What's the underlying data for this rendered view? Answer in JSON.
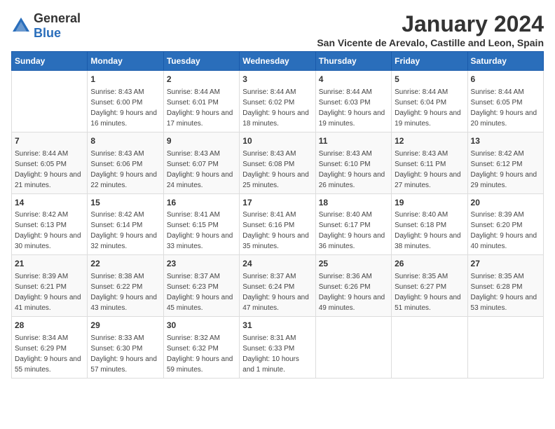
{
  "logo": {
    "text_general": "General",
    "text_blue": "Blue"
  },
  "header": {
    "month_title": "January 2024",
    "subtitle": "San Vicente de Arevalo, Castille and Leon, Spain"
  },
  "days_of_week": [
    "Sunday",
    "Monday",
    "Tuesday",
    "Wednesday",
    "Thursday",
    "Friday",
    "Saturday"
  ],
  "weeks": [
    [
      {
        "day": "",
        "sunrise": "",
        "sunset": "",
        "daylight": ""
      },
      {
        "day": "1",
        "sunrise": "Sunrise: 8:43 AM",
        "sunset": "Sunset: 6:00 PM",
        "daylight": "Daylight: 9 hours and 16 minutes."
      },
      {
        "day": "2",
        "sunrise": "Sunrise: 8:44 AM",
        "sunset": "Sunset: 6:01 PM",
        "daylight": "Daylight: 9 hours and 17 minutes."
      },
      {
        "day": "3",
        "sunrise": "Sunrise: 8:44 AM",
        "sunset": "Sunset: 6:02 PM",
        "daylight": "Daylight: 9 hours and 18 minutes."
      },
      {
        "day": "4",
        "sunrise": "Sunrise: 8:44 AM",
        "sunset": "Sunset: 6:03 PM",
        "daylight": "Daylight: 9 hours and 19 minutes."
      },
      {
        "day": "5",
        "sunrise": "Sunrise: 8:44 AM",
        "sunset": "Sunset: 6:04 PM",
        "daylight": "Daylight: 9 hours and 19 minutes."
      },
      {
        "day": "6",
        "sunrise": "Sunrise: 8:44 AM",
        "sunset": "Sunset: 6:05 PM",
        "daylight": "Daylight: 9 hours and 20 minutes."
      }
    ],
    [
      {
        "day": "7",
        "sunrise": "Sunrise: 8:44 AM",
        "sunset": "Sunset: 6:05 PM",
        "daylight": "Daylight: 9 hours and 21 minutes."
      },
      {
        "day": "8",
        "sunrise": "Sunrise: 8:43 AM",
        "sunset": "Sunset: 6:06 PM",
        "daylight": "Daylight: 9 hours and 22 minutes."
      },
      {
        "day": "9",
        "sunrise": "Sunrise: 8:43 AM",
        "sunset": "Sunset: 6:07 PM",
        "daylight": "Daylight: 9 hours and 24 minutes."
      },
      {
        "day": "10",
        "sunrise": "Sunrise: 8:43 AM",
        "sunset": "Sunset: 6:08 PM",
        "daylight": "Daylight: 9 hours and 25 minutes."
      },
      {
        "day": "11",
        "sunrise": "Sunrise: 8:43 AM",
        "sunset": "Sunset: 6:10 PM",
        "daylight": "Daylight: 9 hours and 26 minutes."
      },
      {
        "day": "12",
        "sunrise": "Sunrise: 8:43 AM",
        "sunset": "Sunset: 6:11 PM",
        "daylight": "Daylight: 9 hours and 27 minutes."
      },
      {
        "day": "13",
        "sunrise": "Sunrise: 8:42 AM",
        "sunset": "Sunset: 6:12 PM",
        "daylight": "Daylight: 9 hours and 29 minutes."
      }
    ],
    [
      {
        "day": "14",
        "sunrise": "Sunrise: 8:42 AM",
        "sunset": "Sunset: 6:13 PM",
        "daylight": "Daylight: 9 hours and 30 minutes."
      },
      {
        "day": "15",
        "sunrise": "Sunrise: 8:42 AM",
        "sunset": "Sunset: 6:14 PM",
        "daylight": "Daylight: 9 hours and 32 minutes."
      },
      {
        "day": "16",
        "sunrise": "Sunrise: 8:41 AM",
        "sunset": "Sunset: 6:15 PM",
        "daylight": "Daylight: 9 hours and 33 minutes."
      },
      {
        "day": "17",
        "sunrise": "Sunrise: 8:41 AM",
        "sunset": "Sunset: 6:16 PM",
        "daylight": "Daylight: 9 hours and 35 minutes."
      },
      {
        "day": "18",
        "sunrise": "Sunrise: 8:40 AM",
        "sunset": "Sunset: 6:17 PM",
        "daylight": "Daylight: 9 hours and 36 minutes."
      },
      {
        "day": "19",
        "sunrise": "Sunrise: 8:40 AM",
        "sunset": "Sunset: 6:18 PM",
        "daylight": "Daylight: 9 hours and 38 minutes."
      },
      {
        "day": "20",
        "sunrise": "Sunrise: 8:39 AM",
        "sunset": "Sunset: 6:20 PM",
        "daylight": "Daylight: 9 hours and 40 minutes."
      }
    ],
    [
      {
        "day": "21",
        "sunrise": "Sunrise: 8:39 AM",
        "sunset": "Sunset: 6:21 PM",
        "daylight": "Daylight: 9 hours and 41 minutes."
      },
      {
        "day": "22",
        "sunrise": "Sunrise: 8:38 AM",
        "sunset": "Sunset: 6:22 PM",
        "daylight": "Daylight: 9 hours and 43 minutes."
      },
      {
        "day": "23",
        "sunrise": "Sunrise: 8:37 AM",
        "sunset": "Sunset: 6:23 PM",
        "daylight": "Daylight: 9 hours and 45 minutes."
      },
      {
        "day": "24",
        "sunrise": "Sunrise: 8:37 AM",
        "sunset": "Sunset: 6:24 PM",
        "daylight": "Daylight: 9 hours and 47 minutes."
      },
      {
        "day": "25",
        "sunrise": "Sunrise: 8:36 AM",
        "sunset": "Sunset: 6:26 PM",
        "daylight": "Daylight: 9 hours and 49 minutes."
      },
      {
        "day": "26",
        "sunrise": "Sunrise: 8:35 AM",
        "sunset": "Sunset: 6:27 PM",
        "daylight": "Daylight: 9 hours and 51 minutes."
      },
      {
        "day": "27",
        "sunrise": "Sunrise: 8:35 AM",
        "sunset": "Sunset: 6:28 PM",
        "daylight": "Daylight: 9 hours and 53 minutes."
      }
    ],
    [
      {
        "day": "28",
        "sunrise": "Sunrise: 8:34 AM",
        "sunset": "Sunset: 6:29 PM",
        "daylight": "Daylight: 9 hours and 55 minutes."
      },
      {
        "day": "29",
        "sunrise": "Sunrise: 8:33 AM",
        "sunset": "Sunset: 6:30 PM",
        "daylight": "Daylight: 9 hours and 57 minutes."
      },
      {
        "day": "30",
        "sunrise": "Sunrise: 8:32 AM",
        "sunset": "Sunset: 6:32 PM",
        "daylight": "Daylight: 9 hours and 59 minutes."
      },
      {
        "day": "31",
        "sunrise": "Sunrise: 8:31 AM",
        "sunset": "Sunset: 6:33 PM",
        "daylight": "Daylight: 10 hours and 1 minute."
      },
      {
        "day": "",
        "sunrise": "",
        "sunset": "",
        "daylight": ""
      },
      {
        "day": "",
        "sunrise": "",
        "sunset": "",
        "daylight": ""
      },
      {
        "day": "",
        "sunrise": "",
        "sunset": "",
        "daylight": ""
      }
    ]
  ]
}
